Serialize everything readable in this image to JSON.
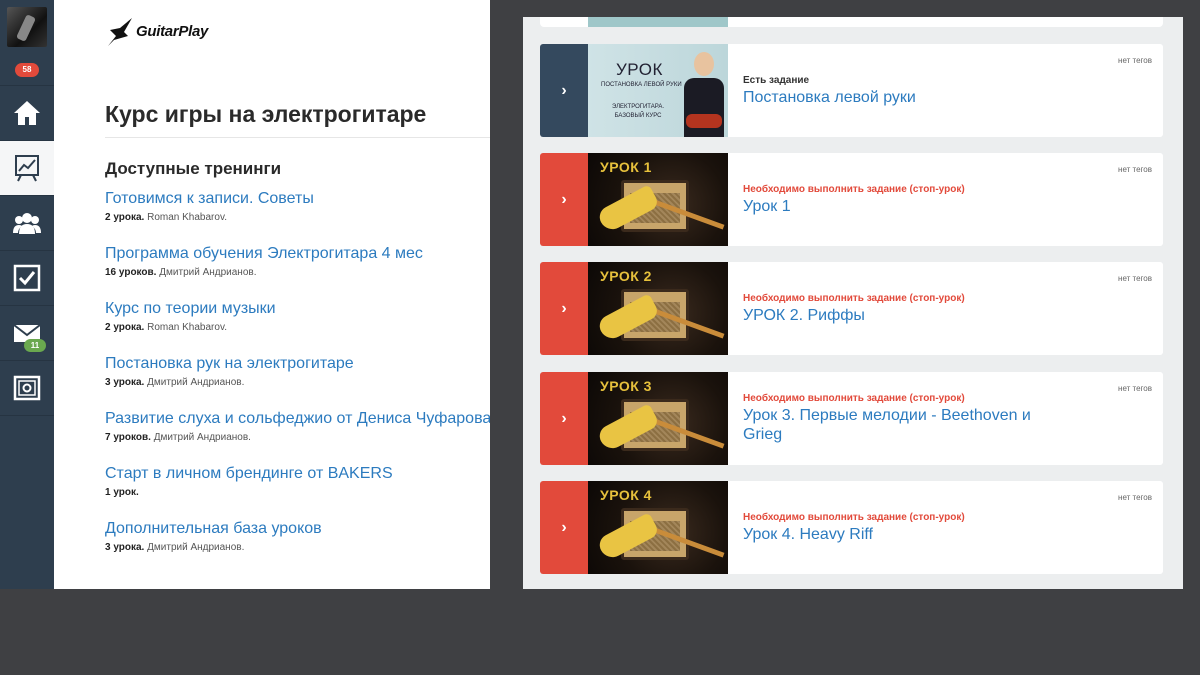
{
  "sidebar": {
    "notification_count": "58",
    "mail_count": "11",
    "items": [
      {
        "name": "home"
      },
      {
        "name": "trainings",
        "active": true
      },
      {
        "name": "users"
      },
      {
        "name": "tasks"
      },
      {
        "name": "messages"
      },
      {
        "name": "safe"
      }
    ]
  },
  "logo": {
    "text": "GuitarPlay"
  },
  "page": {
    "title": "Курс игры на электрогитаре",
    "section_title": "Доступные тренинги"
  },
  "trainings": [
    {
      "name": "Готовимся к записи. Советы",
      "count": "2 урока.",
      "author": "Roman Khabarov."
    },
    {
      "name": "Программа обучения Электрогитара 4 мес",
      "count": "16 уроков.",
      "author": "Дмитрий Андрианов."
    },
    {
      "name": "Курс по теории музыки",
      "count": "2 урока.",
      "author": "Roman Khabarov."
    },
    {
      "name": "Постановка рук на электрогитаре",
      "count": "3 урока.",
      "author": "Дмитрий Андрианов."
    },
    {
      "name": "Развитие слуха и сольфеджио от Дениса Чуфарова",
      "count": "7 уроков.",
      "author": "Дмитрий Андрианов."
    },
    {
      "name": "Старт в личном брендинге от BAKERS",
      "count": "1 урок.",
      "author": ""
    },
    {
      "name": "Дополнительная база уроков",
      "count": "3 урока.",
      "author": "Дмитрий Андрианов."
    }
  ],
  "lessons": [
    {
      "thumb_caption": "УРОК",
      "thumb_sub1": "ПОСТАНОВКА ЛЕВОЙ РУКИ",
      "thumb_sub2": "ЭЛЕКТРОГИТАРА.",
      "thumb_sub3": "БАЗОВЫЙ КУРС",
      "status": "Есть задание",
      "title": "Постановка левой руки",
      "tags": "нет тегов",
      "accent": "#34495e"
    },
    {
      "thumb_caption": "УРОК 1",
      "status": "Необходимо выполнить задание (стоп-урок)",
      "title": "Урок 1",
      "tags": "нет тегов",
      "accent": "#e24a3b"
    },
    {
      "thumb_caption": "УРОК 2",
      "status": "Необходимо выполнить задание (стоп-урок)",
      "title": "УРОК 2. Риффы",
      "tags": "нет тегов",
      "accent": "#e24a3b"
    },
    {
      "thumb_caption": "УРОК 3",
      "status": "Необходимо выполнить задание (стоп-урок)",
      "title": "Урок 3. Первые мелодии - Beethoven и Grieg",
      "tags": "нет тегов",
      "accent": "#e24a3b"
    },
    {
      "thumb_caption": "УРОК 4",
      "status": "Необходимо выполнить задание (стоп-урок)",
      "title": "Урок 4. Heavy Riff",
      "tags": "нет тегов",
      "accent": "#e24a3b"
    }
  ],
  "colors": {
    "sidebar_bg": "#2e3e4e",
    "link": "#2c7bbf",
    "stop_red": "#e24a3b",
    "badge_green": "#6aa84f"
  }
}
